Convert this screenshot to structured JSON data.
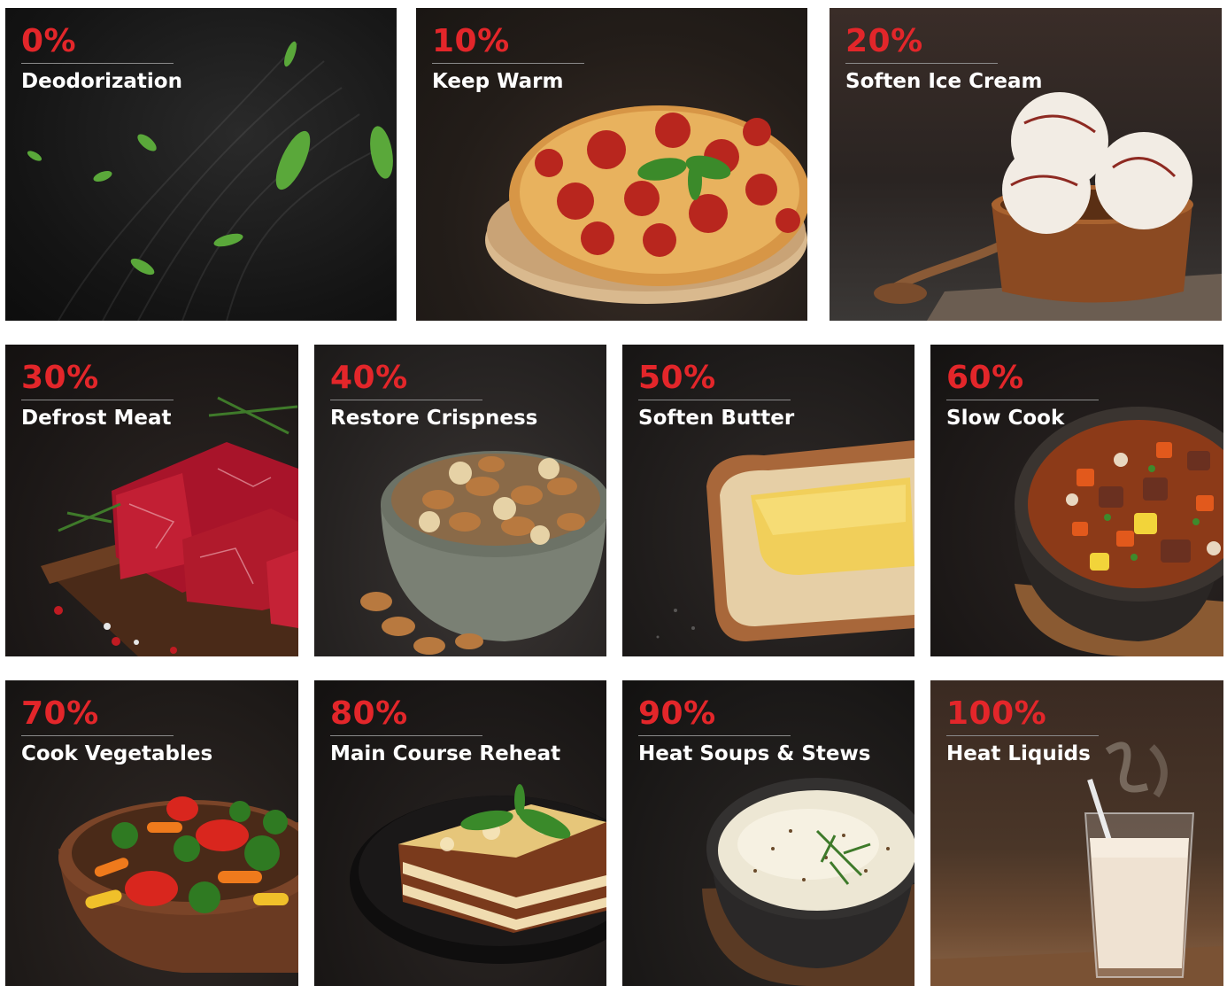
{
  "tiles": [
    {
      "percent": "0%",
      "label": "Deodorization",
      "icon": "leaves-icon"
    },
    {
      "percent": "10%",
      "label": "Keep Warm",
      "icon": "pizza-icon"
    },
    {
      "percent": "20%",
      "label": "Soften Ice Cream",
      "icon": "ice-cream-icon"
    },
    {
      "percent": "30%",
      "label": "Defrost Meat",
      "icon": "meat-icon"
    },
    {
      "percent": "40%",
      "label": "Restore Crispness",
      "icon": "nuts-bowl-icon"
    },
    {
      "percent": "50%",
      "label": "Soften Butter",
      "icon": "butter-toast-icon"
    },
    {
      "percent": "60%",
      "label": "Slow Cook",
      "icon": "stew-bowl-icon"
    },
    {
      "percent": "70%",
      "label": "Cook Vegetables",
      "icon": "vegetables-plate-icon"
    },
    {
      "percent": "80%",
      "label": "Main Course Reheat",
      "icon": "lasagna-icon"
    },
    {
      "percent": "90%",
      "label": "Heat Soups & Stews",
      "icon": "soup-bowl-icon"
    },
    {
      "percent": "100%",
      "label": "Heat Liquids",
      "icon": "milk-glass-icon"
    }
  ],
  "colors": {
    "accent": "#e3262a",
    "label_text": "#ffffff",
    "tile_background": "#1b1918",
    "page_background": "#ffffff"
  }
}
